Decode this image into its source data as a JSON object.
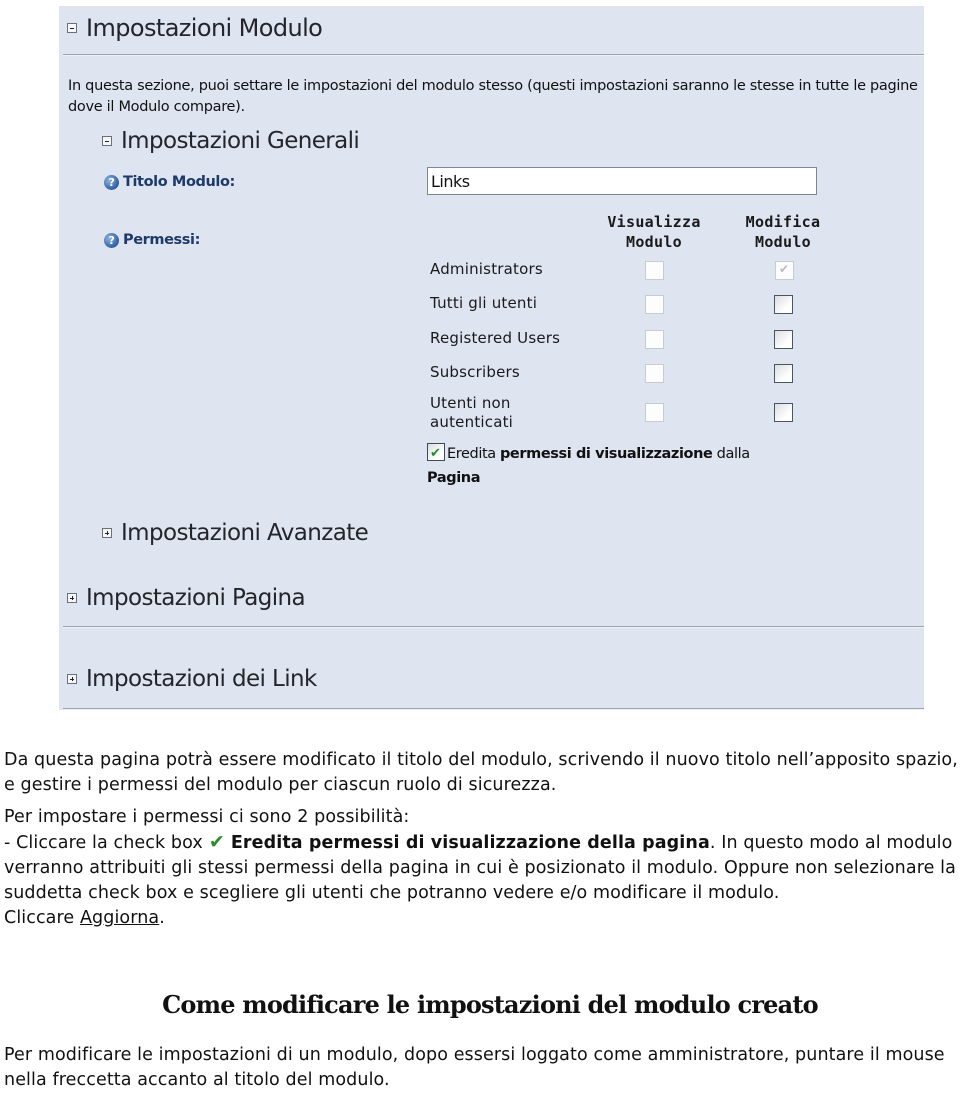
{
  "panel": {
    "main_section": {
      "title": "Impostazioni Modulo",
      "state": "expanded"
    },
    "intro_text": "In questa sezione, puoi settare le impostazioni del modulo stesso (questi impostazioni saranno le stesse in tutte le pagine dove il Modulo compare).",
    "general_section": {
      "title": "Impostazioni Generali",
      "state": "expanded",
      "module_title_label": "Titolo Modulo:",
      "module_title_value": "Links",
      "permissions_label": "Permessi:",
      "columns": [
        "Visualizza Modulo",
        "Modifica Modulo"
      ],
      "column_lines": [
        [
          "Visualizza",
          "Modulo"
        ],
        [
          "Modifica",
          "Modulo"
        ]
      ],
      "roles": [
        {
          "name": "Administrators",
          "view": false,
          "view_enabled": false,
          "edit": true,
          "edit_enabled": false
        },
        {
          "name": "Tutti gli utenti",
          "view": false,
          "view_enabled": false,
          "edit": false,
          "edit_enabled": true
        },
        {
          "name": "Registered Users",
          "view": false,
          "view_enabled": false,
          "edit": false,
          "edit_enabled": true
        },
        {
          "name": "Subscribers",
          "view": false,
          "view_enabled": false,
          "edit": false,
          "edit_enabled": true
        },
        {
          "name": "Utenti non autenticati",
          "name_lines": [
            "Utenti non",
            "autenticati"
          ],
          "view": false,
          "view_enabled": false,
          "edit": false,
          "edit_enabled": true
        }
      ],
      "inherit": {
        "checked": true,
        "prefix": "Eredita",
        "bold": "permessi di visualizzazione",
        "suffix": "dalla",
        "last_bold": "Pagina"
      }
    },
    "advanced_section": {
      "title": "Impostazioni Avanzate",
      "state": "collapsed"
    },
    "page_section": {
      "title": "Impostazioni Pagina",
      "state": "collapsed"
    },
    "links_section": {
      "title": "Impostazioni dei Link",
      "state": "collapsed"
    }
  },
  "document": {
    "para1": "Da questa pagina potrà essere modificato il titolo del modulo, scrivendo il nuovo titolo nell’apposito spazio, e gestire i permessi del modulo per ciascun ruolo di sicurezza.",
    "para2_intro": "Per impostare i permessi ci sono 2 possibilità:",
    "para2_line_prefix": "- Cliccare la check box",
    "para2_bold": "Eredita permessi di visualizzazione della pagina",
    "para2_rest": ". In questo modo al modulo verranno attribuiti gli stessi permessi della pagina in cui è posizionato il modulo.  Oppure non selezionare la suddetta check box e scegliere gli utenti che potranno vedere e/o modificare il modulo.",
    "click_prefix": "Cliccare",
    "click_link": "Aggiorna",
    "click_suffix": ".",
    "heading": "Come modificare le impostazioni del modulo creato",
    "para3": "Per modificare le impostazioni di un modulo, dopo essersi loggato come amministratore, puntare il mouse nella freccetta accanto al titolo del modulo."
  },
  "icons": {
    "collapse": "minus-box-icon",
    "expand": "plus-box-icon",
    "help": "help-question-icon",
    "check": "checkmark-icon"
  },
  "colors": {
    "panel_bg": "#dfe4f1",
    "label_blue": "#1d3a6b",
    "check_green": "#2e8b2e"
  }
}
